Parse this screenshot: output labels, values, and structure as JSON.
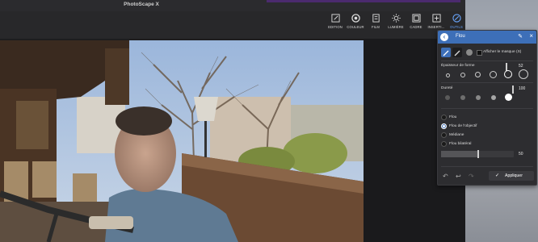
{
  "window": {
    "title": "PhotoScape X"
  },
  "toolbar": {
    "tools": [
      {
        "label": "EDITION",
        "icon": "edit-icon"
      },
      {
        "label": "COULEUR",
        "icon": "color-icon"
      },
      {
        "label": "FILM",
        "icon": "film-icon"
      },
      {
        "label": "LUMIÈRE",
        "icon": "light-icon"
      },
      {
        "label": "CADRE",
        "icon": "frame-icon"
      },
      {
        "label": "INSERTI...",
        "icon": "insert-icon"
      },
      {
        "label": "OUTILS",
        "icon": "tools-icon"
      }
    ],
    "active_tool": "OUTILS",
    "accent": "#6aa7ff"
  },
  "panel": {
    "title": "Flou",
    "header_color": "#3d6fb8",
    "show_mask_label": "Afficher le masque (S)",
    "brush_width_label": "Épaisseur de forme",
    "brush_width_value": "52",
    "hardness_label": "Dureté",
    "hardness_value": "100",
    "options": [
      {
        "label": "Flou",
        "selected": false
      },
      {
        "label": "Flou de l'objectif",
        "selected": true
      },
      {
        "label": "Médiane",
        "selected": false
      },
      {
        "label": "Flou bilatéral",
        "selected": false
      }
    ],
    "intensity_label": "Intensité",
    "intensity_value": "50",
    "apply_label": "Appliquer"
  }
}
